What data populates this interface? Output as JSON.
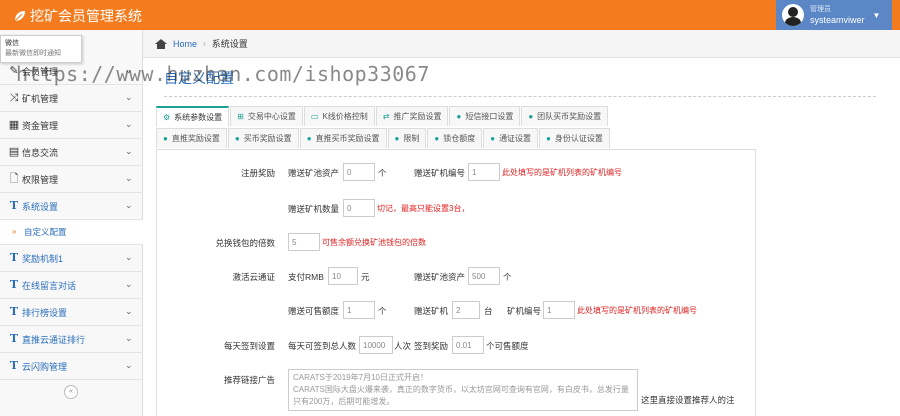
{
  "app": {
    "title": "挖矿会员管理系统"
  },
  "user": {
    "role": "管理员",
    "name": "systeamviwer"
  },
  "notice": {
    "title": "微信",
    "subtitle": "最新微信即时通知"
  },
  "watermark": "https://www.huzhan.com/ishop33067",
  "sidebar": {
    "items": [
      {
        "label": "会员管理",
        "icon": "edit-icon"
      },
      {
        "label": "矿机管理",
        "icon": "shuffle-icon"
      },
      {
        "label": "资金管理",
        "icon": "calendar-icon"
      },
      {
        "label": "信息交流",
        "icon": "list-icon"
      },
      {
        "label": "权限管理",
        "icon": "file-icon"
      },
      {
        "label": "系统设置",
        "icon": "text-t-icon"
      },
      {
        "label": "奖励机制1",
        "icon": "text-t-icon"
      },
      {
        "label": "在线留言对话",
        "icon": "text-t-icon"
      },
      {
        "label": "排行榜设置",
        "icon": "text-t-icon"
      },
      {
        "label": "直推云通证排行",
        "icon": "text-t-icon"
      },
      {
        "label": "云闪购管理",
        "icon": "text-t-icon"
      }
    ],
    "sub_item": "自定义配置",
    "collapse": "«"
  },
  "breadcrumb": {
    "home": "Home",
    "current": "系统设置"
  },
  "page_title": "自定义配置",
  "tabs_row1": [
    "系统参数设置",
    "交易中心设置",
    "K线价格控制",
    "推广奖励设置",
    "短信接口设置",
    "团队买币奖励设置"
  ],
  "tabs_row2": [
    "直推奖励设置",
    "买币奖励设置",
    "直推买币奖励设置",
    "限制",
    "锁仓额度",
    "通证设置",
    "身份认证设置"
  ],
  "form": {
    "register_reward": {
      "label": "注册奖励",
      "gift_assets_label": "赠送矿池资产",
      "gift_assets_value": "0",
      "unit_ge": "个",
      "gift_miner_no_label": "赠送矿机编号",
      "gift_miner_no_value": "1",
      "hint1": "此处填写的是矿机列表的矿机编号",
      "gift_miner_count_label": "赠送矿机数量",
      "gift_miner_count_value": "0",
      "hint2": "切记，最高只能设置3台，"
    },
    "exchange": {
      "label": "兑换钱包的倍数",
      "value": "5",
      "hint": "可售余额兑换矿池钱包的倍数"
    },
    "activate": {
      "label": "激活云通证",
      "pay_label": "支付RMB",
      "pay_value": "10",
      "pay_unit": "元",
      "gift_assets_label": "赠送矿池资产",
      "gift_assets_value": "500",
      "unit_ge": "个",
      "gift_sell_label": "赠送可售额度",
      "gift_sell_value": "1",
      "unit_ge2": "个",
      "gift_miner_label": "赠送矿机",
      "gift_miner_value": "2",
      "unit_tai": "台",
      "miner_no_label": "矿机编号",
      "miner_no_value": "1",
      "hint": "此处填写的是矿机列表的矿机编号"
    },
    "checkin": {
      "label": "每天签到设置",
      "total_label": "每天可签到总人数",
      "total_value": "10000",
      "unit_ren": "人次",
      "reward_label": "签到奖励",
      "reward_value": "0.01",
      "unit_edu": "个可售额度"
    },
    "promo": {
      "label": "推荐链接广告",
      "text": "CARATS于2019年7月10日正式开启！\nCARATS国际大盘火爆来袭，真正的数字货币，以太坊官网可查询有官网，有白皮书，总发行量只有200万，后期可能增发。",
      "side_note": "这里直接设置推荐人的注"
    }
  },
  "colors": {
    "topbar": "#f47c1f",
    "userbox": "#5b87c6",
    "accent": "#2a6ebb",
    "hint": "#e02020"
  }
}
